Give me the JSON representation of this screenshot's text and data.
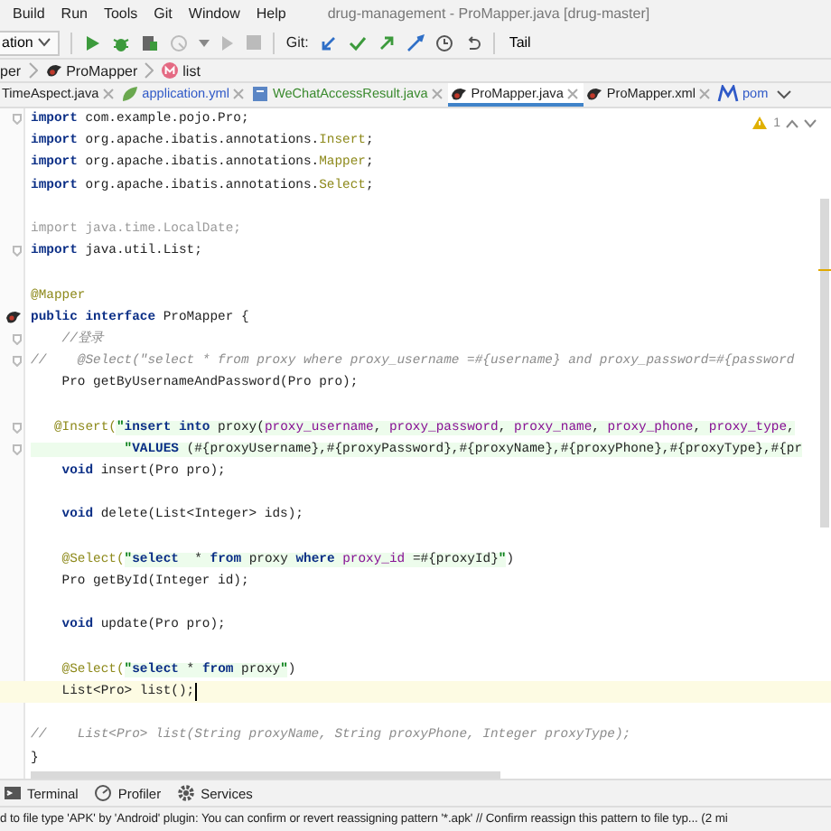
{
  "menu": [
    "Build",
    "Run",
    "Tools",
    "Git",
    "Window",
    "Help"
  ],
  "window": {
    "title": "drug-management - ProMapper.java [drug-master]"
  },
  "toolbar": {
    "config": "ation",
    "git_label": "Git:",
    "tail": "Tail"
  },
  "breadcrumb": [
    {
      "label": "per",
      "kind": "plain"
    },
    {
      "label": "ProMapper",
      "kind": "mapper"
    },
    {
      "label": "list",
      "kind": "method"
    }
  ],
  "tabs": [
    {
      "label": "TimeAspect.java",
      "kind": "plain",
      "color": "#1f1f1f",
      "selected": false
    },
    {
      "label": "application.yml",
      "kind": "yml",
      "color": "#2f59c7",
      "selected": false
    },
    {
      "label": "WeChatAccessResult.java",
      "kind": "class",
      "color": "#3a8a2e",
      "selected": false
    },
    {
      "label": "ProMapper.java",
      "kind": "mapper",
      "color": "#1f1f1f",
      "selected": true
    },
    {
      "label": "ProMapper.xml",
      "kind": "mapper",
      "color": "#1f1f1f",
      "selected": false
    },
    {
      "label": "pom",
      "kind": "maven",
      "color": "#2f59c7",
      "selected": false
    }
  ],
  "inspection": {
    "count": "1"
  },
  "lines": [
    {
      "kind": "fold",
      "current": false,
      "segs": [
        {
          "kind": "kw",
          "text": "import"
        },
        {
          "kind": "plain",
          "text": " com.example.pojo.Pro;"
        }
      ]
    },
    {
      "kind": "code",
      "current": false,
      "segs": [
        {
          "kind": "kw",
          "text": "import"
        },
        {
          "kind": "plain",
          "text": " org.apache.ibatis.annotations."
        },
        {
          "kind": "ann",
          "text": "Insert"
        },
        {
          "kind": "plain",
          "text": ";"
        }
      ]
    },
    {
      "kind": "code",
      "current": false,
      "segs": [
        {
          "kind": "kw",
          "text": "import"
        },
        {
          "kind": "plain",
          "text": " org.apache.ibatis.annotations."
        },
        {
          "kind": "ann",
          "text": "Mapper"
        },
        {
          "kind": "plain",
          "text": ";"
        }
      ]
    },
    {
      "kind": "code",
      "current": false,
      "segs": [
        {
          "kind": "kw",
          "text": "import"
        },
        {
          "kind": "plain",
          "text": " org.apache.ibatis.annotations."
        },
        {
          "kind": "ann",
          "text": "Select"
        },
        {
          "kind": "plain",
          "text": ";"
        }
      ]
    },
    {
      "kind": "blank"
    },
    {
      "kind": "code",
      "current": false,
      "segs": [
        {
          "kind": "unused",
          "text": "import java.time.LocalDate;"
        }
      ]
    },
    {
      "kind": "fold",
      "current": false,
      "segs": [
        {
          "kind": "kw",
          "text": "import"
        },
        {
          "kind": "plain",
          "text": " java.util.List;"
        }
      ]
    },
    {
      "kind": "blank"
    },
    {
      "kind": "code",
      "current": false,
      "segs": [
        {
          "kind": "ann",
          "text": "@Mapper"
        }
      ]
    },
    {
      "kind": "mapper",
      "current": false,
      "segs": [
        {
          "kind": "kw",
          "text": "public interface"
        },
        {
          "kind": "plain",
          "text": " ProMapper {"
        }
      ]
    },
    {
      "kind": "fold",
      "current": false,
      "segs": [
        {
          "kind": "cmt",
          "text": "    //登录"
        }
      ]
    },
    {
      "kind": "fold",
      "current": false,
      "segs": [
        {
          "kind": "cmt",
          "text": "//    @Select(\"select * from proxy where proxy_username =#{username} and proxy_password=#{password"
        }
      ]
    },
    {
      "kind": "code",
      "current": false,
      "segs": [
        {
          "kind": "plain",
          "text": "    Pro getByUsernameAndPassword(Pro pro);"
        }
      ]
    },
    {
      "kind": "blank"
    },
    {
      "kind": "fold",
      "current": false,
      "segs": [
        {
          "kind": "ann",
          "text": "   @Insert("
        },
        {
          "kind": "str",
          "text": "\""
        },
        {
          "kind": "sqlkw",
          "text": "insert into"
        },
        {
          "kind": "sqlpl",
          "text": " proxy("
        },
        {
          "kind": "sqlid",
          "text": "proxy_username"
        },
        {
          "kind": "sqlpl",
          "text": ", "
        },
        {
          "kind": "sqlid",
          "text": "proxy_password"
        },
        {
          "kind": "sqlpl",
          "text": ", "
        },
        {
          "kind": "sqlid",
          "text": "proxy_name"
        },
        {
          "kind": "sqlpl",
          "text": ", "
        },
        {
          "kind": "sqlid",
          "text": "proxy_phone"
        },
        {
          "kind": "sqlpl",
          "text": ", "
        },
        {
          "kind": "sqlid",
          "text": "proxy_type"
        },
        {
          "kind": "sqlpl",
          "text": ","
        }
      ]
    },
    {
      "kind": "fold",
      "current": false,
      "segs": [
        {
          "kind": "str",
          "text": "            \""
        },
        {
          "kind": "sqlkw",
          "text": "VALUES"
        },
        {
          "kind": "sqlpl",
          "text": " (#{proxyUsername},#{proxyPassword},#{proxyName},#{proxyPhone},#{proxyType},#{pr"
        }
      ]
    },
    {
      "kind": "code",
      "current": false,
      "segs": [
        {
          "kind": "kw",
          "text": "    void"
        },
        {
          "kind": "plain",
          "text": " insert(Pro pro);"
        }
      ]
    },
    {
      "kind": "blank"
    },
    {
      "kind": "code",
      "current": false,
      "segs": [
        {
          "kind": "kw",
          "text": "    void"
        },
        {
          "kind": "plain",
          "text": " delete(List<Integer> ids);"
        }
      ]
    },
    {
      "kind": "blank"
    },
    {
      "kind": "code",
      "current": false,
      "segs": [
        {
          "kind": "ann",
          "text": "    @Select("
        },
        {
          "kind": "str",
          "text": "\""
        },
        {
          "kind": "sqlkw",
          "text": "select"
        },
        {
          "kind": "sqlpl",
          "text": "  * "
        },
        {
          "kind": "sqlkw",
          "text": "from"
        },
        {
          "kind": "sqlpl",
          "text": " proxy "
        },
        {
          "kind": "sqlkw",
          "text": "where"
        },
        {
          "kind": "sqlid",
          "text": " proxy_id"
        },
        {
          "kind": "sqlpl",
          "text": " =#{proxyId}"
        },
        {
          "kind": "str",
          "text": "\""
        },
        {
          "kind": "plain",
          "text": ")"
        }
      ]
    },
    {
      "kind": "code",
      "current": false,
      "segs": [
        {
          "kind": "plain",
          "text": "    Pro getById(Integer id);"
        }
      ]
    },
    {
      "kind": "blank"
    },
    {
      "kind": "code",
      "current": false,
      "segs": [
        {
          "kind": "kw",
          "text": "    void"
        },
        {
          "kind": "plain",
          "text": " update(Pro pro);"
        }
      ]
    },
    {
      "kind": "blank"
    },
    {
      "kind": "code",
      "current": false,
      "segs": [
        {
          "kind": "ann",
          "text": "    @Select("
        },
        {
          "kind": "str",
          "text": "\""
        },
        {
          "kind": "sqlkw",
          "text": "select"
        },
        {
          "kind": "sqlpl",
          "text": " * "
        },
        {
          "kind": "sqlkw",
          "text": "from"
        },
        {
          "kind": "sqlpl",
          "text": " proxy"
        },
        {
          "kind": "str",
          "text": "\""
        },
        {
          "kind": "plain",
          "text": ")"
        }
      ]
    },
    {
      "kind": "code",
      "current": true,
      "segs": [
        {
          "kind": "plain",
          "text": "    List<Pro> list();"
        }
      ]
    },
    {
      "kind": "blank"
    },
    {
      "kind": "code",
      "current": false,
      "segs": [
        {
          "kind": "cmt",
          "text": "//    List<Pro> list(String proxyName, String proxyPhone, Integer proxyType);"
        }
      ]
    },
    {
      "kind": "code",
      "current": false,
      "segs": [
        {
          "kind": "plain",
          "text": "}"
        }
      ]
    }
  ],
  "tool_windows": [
    {
      "label": "Terminal",
      "kind": "terminal"
    },
    {
      "label": "Profiler",
      "kind": "profiler"
    },
    {
      "label": "Services",
      "kind": "services"
    }
  ],
  "status_bar": "d to file type 'APK' by 'Android' plugin: You can confirm or revert reassigning pattern '*.apk' // Confirm reassign this pattern to file typ... (2 mi"
}
